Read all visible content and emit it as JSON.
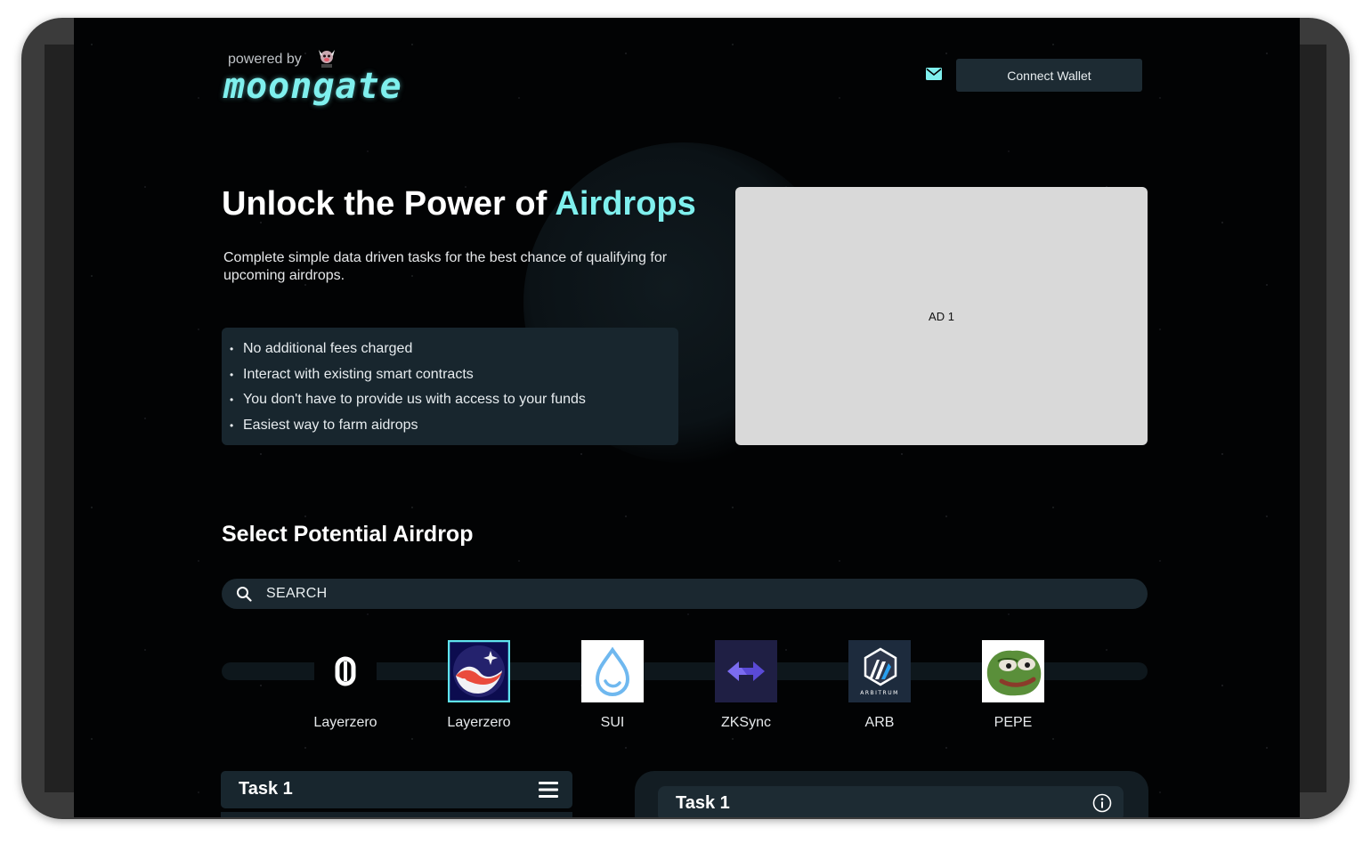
{
  "header": {
    "powered_by": "powered by",
    "brand": "moongate",
    "connect_wallet": "Connect Wallet",
    "icons": {
      "mail": "mail-icon",
      "mascot": "mascot-icon"
    }
  },
  "hero": {
    "title_prefix": "Unlock the Power of ",
    "title_accent": "Airdrops",
    "subtitle": "Complete simple data driven tasks for  the best chance of qualifying for upcoming airdrops.",
    "features": [
      "No additional fees charged",
      "Interact with existing smart contracts",
      "You don't have to provide us with access to your funds",
      "Easiest way to farm aidrops"
    ]
  },
  "ad": {
    "label": "AD 1"
  },
  "airdrop": {
    "section_title": "Select Potential Airdrop",
    "search_placeholder": "SEARCH",
    "tokens": [
      {
        "label": "Layerzero",
        "icon": "layerzero-icon"
      },
      {
        "label": "Layerzero",
        "icon": "starknet-icon",
        "selected": true
      },
      {
        "label": "SUI",
        "icon": "sui-icon"
      },
      {
        "label": "ZKSync",
        "icon": "zksync-icon"
      },
      {
        "label": "ARB",
        "icon": "arbitrum-icon",
        "caption": "ARBITRUM"
      },
      {
        "label": "PEPE",
        "icon": "pepe-icon"
      }
    ]
  },
  "tasks": {
    "left_title": "Task 1",
    "right_title": "Task 1"
  },
  "colors": {
    "accent": "#7ff0ee",
    "background": "#020304",
    "panel": "#18262e",
    "button": "#1d2b33",
    "ad_gray": "#d9d9d9",
    "selected_border": "#5fe3ee"
  }
}
